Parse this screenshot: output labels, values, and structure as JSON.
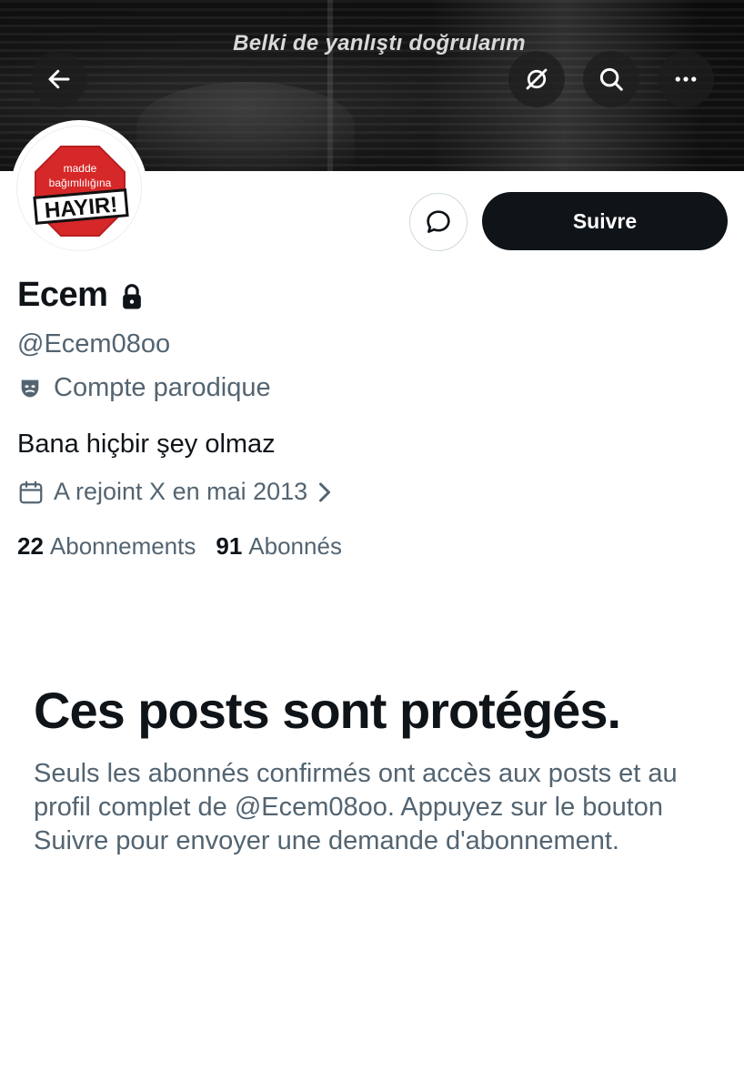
{
  "banner": {
    "text": "Belki de yanlıştı doğrularım"
  },
  "top_nav": {
    "icons": [
      "back-arrow-icon",
      "grok-icon",
      "search-icon",
      "more-icon"
    ]
  },
  "avatar": {
    "line1": "madde",
    "line2": "bağımlılığına",
    "line3": "HAYIR!",
    "sign_color": "#d62828"
  },
  "actions": {
    "message_icon": "message-bubble-icon",
    "follow_label": "Suivre"
  },
  "profile": {
    "name": "Ecem",
    "handle": "@Ecem08oo",
    "parody_label": "Compte parodique",
    "bio": "Bana hiçbir şey olmaz",
    "joined": "A rejoint X en mai 2013",
    "following_count": "22",
    "following_label": "Abonnements",
    "followers_count": "91",
    "followers_label": "Abonnés"
  },
  "protected": {
    "title": "Ces posts sont protégés.",
    "description": "Seuls les abonnés confirmés ont accès aux posts et au profil complet de @Ecem08oo. Appuyez sur le bouton Suivre pour envoyer une demande d'abonnement."
  },
  "colors": {
    "text_primary": "#0f1419",
    "text_secondary": "#536471",
    "button_dark": "#0f1419"
  }
}
